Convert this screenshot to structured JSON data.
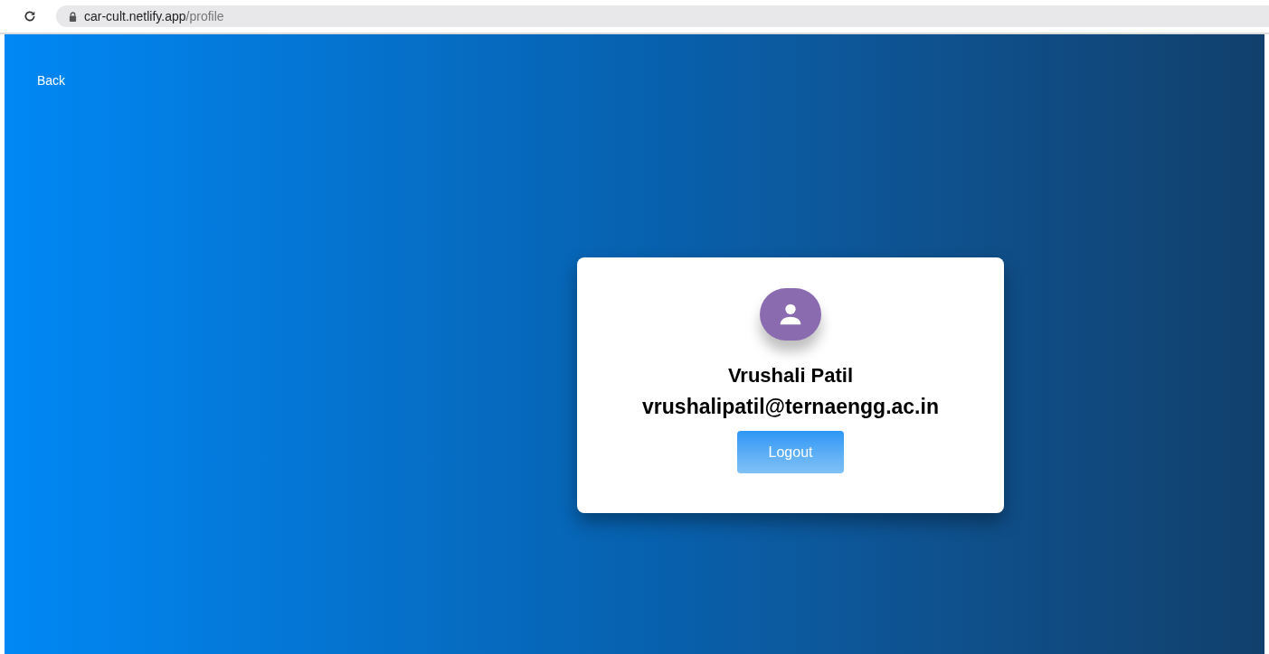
{
  "browser": {
    "url_domain": "car-cult.netlify.app",
    "url_path": "/profile"
  },
  "back_link": "Back",
  "profile": {
    "name": "Vrushali Patil",
    "email": "vrushalipatil@ternaengg.ac.in",
    "logout_button": "Logout"
  }
}
